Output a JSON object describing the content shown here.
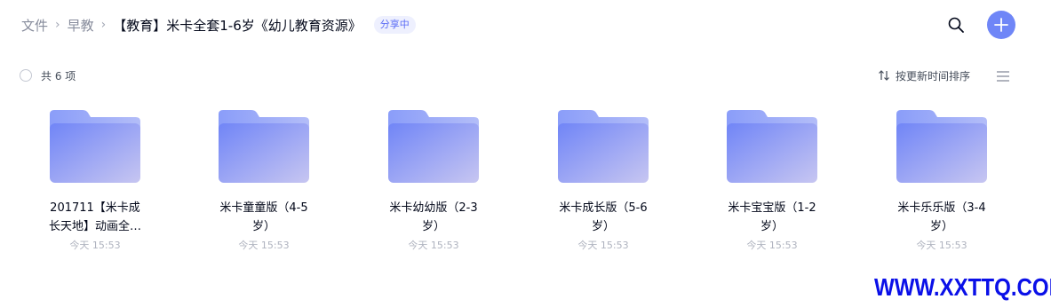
{
  "breadcrumb": {
    "items": [
      "文件",
      "早教"
    ],
    "separator": "›",
    "current": "【教育】米卡全套1-6岁《幼儿教育资源》",
    "badge": "分享中"
  },
  "header": {
    "search_icon": "search-icon",
    "add_icon": "plus-icon"
  },
  "toolbar": {
    "count_label": "共 6 项",
    "sort_label": "按更新时间排序",
    "sort_icon": "sort-arrows-icon",
    "view_icon": "list-view-icon"
  },
  "files": [
    {
      "name_line1": "201711【米卡成",
      "name_line2": "长天地】动画全…",
      "time": "今天 15:53"
    },
    {
      "name_line1": "米卡童童版（4-5",
      "name_line2": "岁）",
      "time": "今天 15:53"
    },
    {
      "name_line1": "米卡幼幼版（2-3",
      "name_line2": "岁）",
      "time": "今天 15:53"
    },
    {
      "name_line1": "米卡成长版（5-6",
      "name_line2": "岁）",
      "time": "今天 15:53"
    },
    {
      "name_line1": "米卡宝宝版（1-2",
      "name_line2": "岁）",
      "time": "今天 15:53"
    },
    {
      "name_line1": "米卡乐乐版（3-4",
      "name_line2": "岁）",
      "time": "今天 15:53"
    }
  ],
  "watermark": "WWW.XXTTQ.COM",
  "colors": {
    "accent": "#6f86f7",
    "badge_bg": "#eef0fe",
    "badge_text": "#5b6cf5",
    "watermark": "#0a10e8"
  }
}
